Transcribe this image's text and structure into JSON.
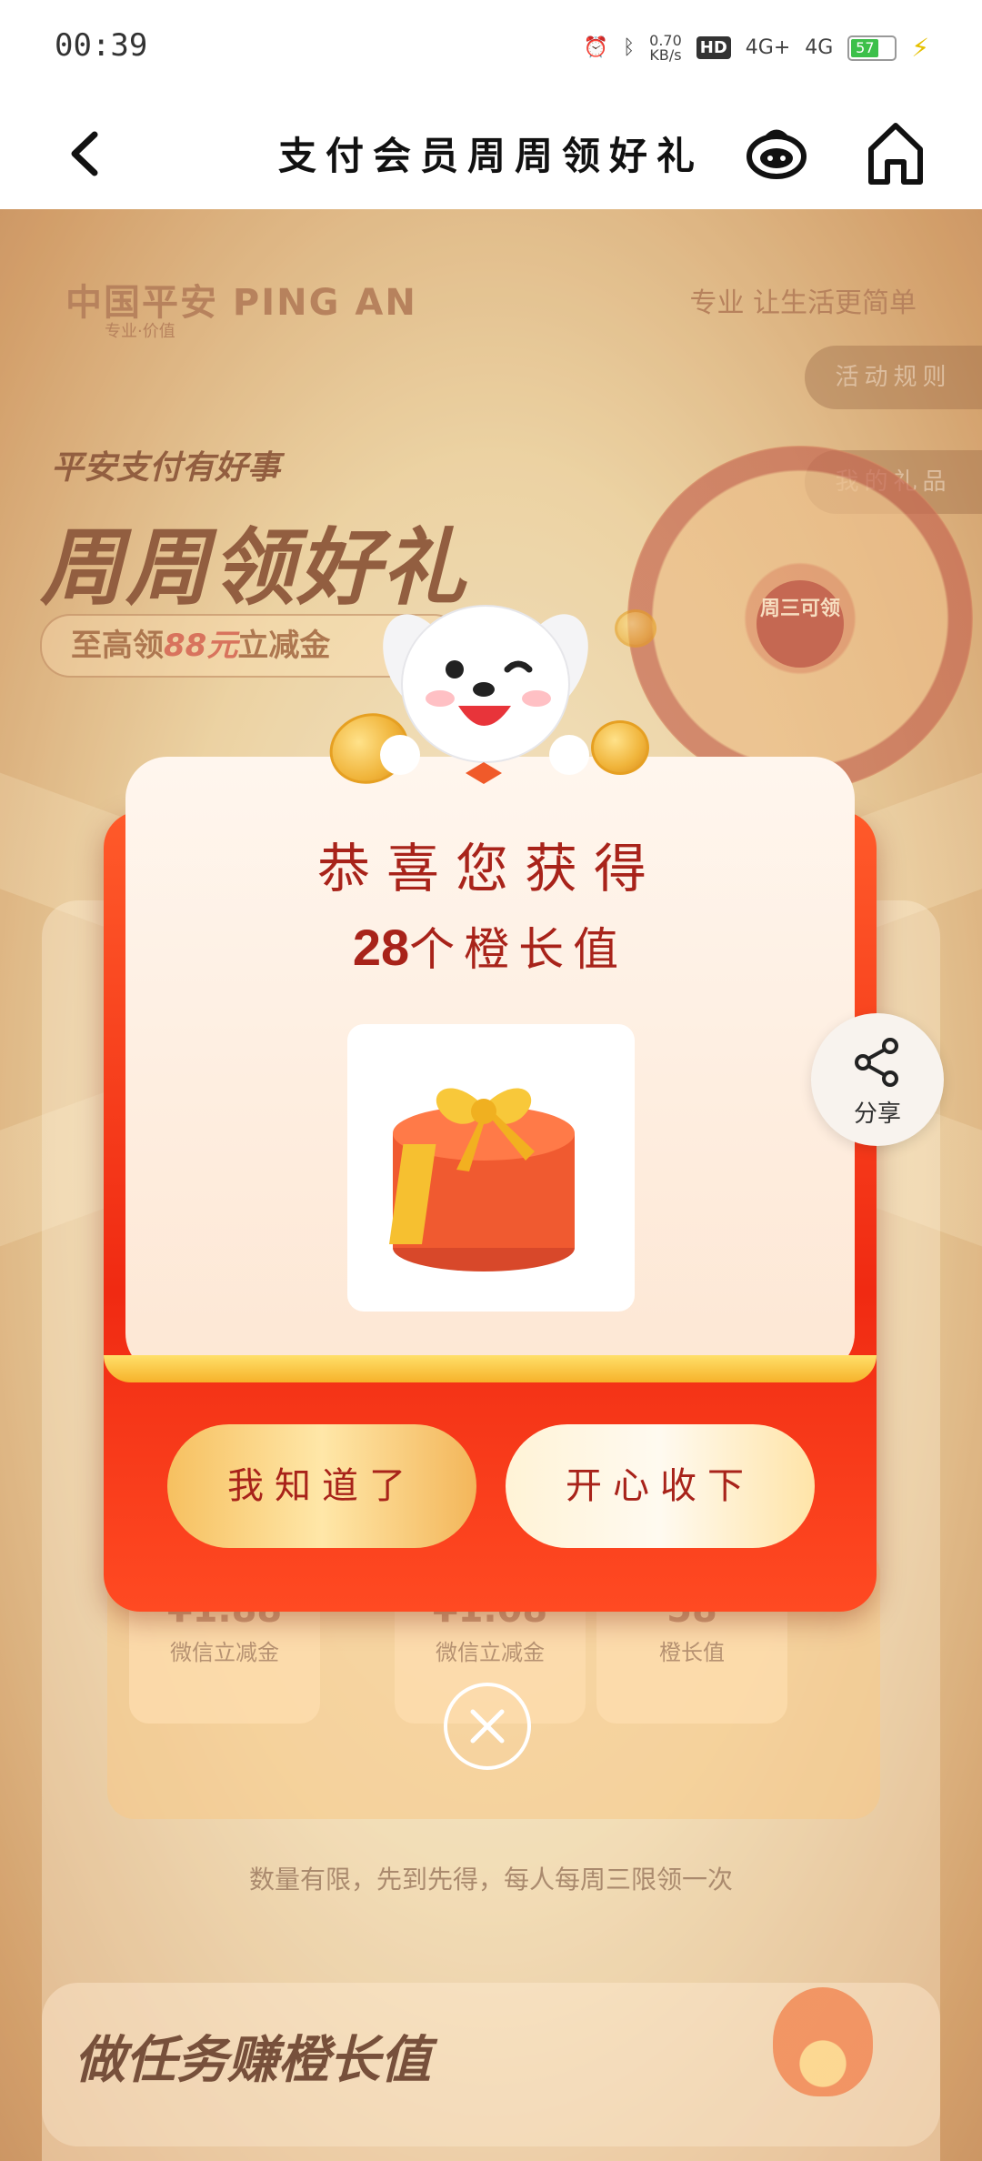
{
  "status_bar": {
    "time": "00:39",
    "net_speed_value": "0.70",
    "net_speed_unit": "KB/s",
    "hd_badge": "HD",
    "signal1_label": "4G+",
    "signal2_label": "4G",
    "battery": "57"
  },
  "header": {
    "title": "支付会员周周领好礼"
  },
  "background": {
    "brand": "中国平安 PING AN",
    "brand_sub": "专业·价值",
    "slogan": "专业 让生活更简单",
    "rules_tab": "活动规则",
    "gifts_tab": "我的礼品",
    "hero_small": "平安支付有好事",
    "hero_big": "周周领好礼",
    "hero_pill_prefix": "至高领",
    "hero_pill_amount": "88元",
    "hero_pill_suffix": "立减金",
    "wheel_center": "周三可领",
    "rewards": [
      {
        "value": "¥1.88",
        "label": "微信立减金"
      },
      {
        "value": "¥1.08",
        "label": "微信立减金"
      },
      {
        "value": "58",
        "label": "橙长值"
      }
    ],
    "limit_note": "数量有限，先到先得，每人每周三限领一次",
    "task_title": "做任务赚橙长值"
  },
  "modal": {
    "title": "恭喜您获得",
    "amount": "28",
    "amount_unit": "个橙长值",
    "btn_know": "我知道了",
    "btn_happy": "开心收下"
  },
  "share": {
    "label": "分享"
  },
  "colors": {
    "modal_red": "#f02a12",
    "modal_text": "#a8231a",
    "cream": "#fff6ee"
  }
}
